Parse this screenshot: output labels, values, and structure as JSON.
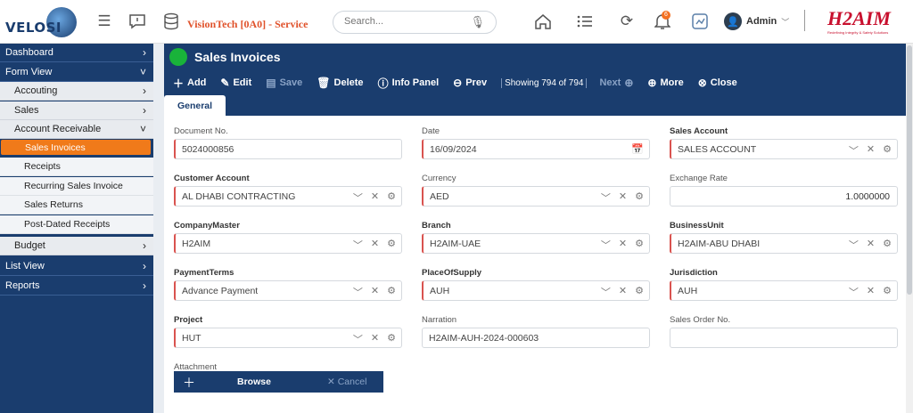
{
  "header": {
    "logo_text": "VELOSI",
    "company": "VisionTech [0A0] - Service",
    "search_placeholder": "Search...",
    "notifications_count": "6",
    "user": "Admin",
    "brand_name": "H2AIM",
    "brand_tagline": "Redefining Integrity & Safety Solutions"
  },
  "sidebar": {
    "dashboard": "Dashboard",
    "form_view": "Form View",
    "accounting": "Accouting",
    "sales": "Sales",
    "account_receivable": "Account Receivable",
    "items": [
      "Sales Invoices",
      "Receipts",
      "Recurring Sales Invoice",
      "Sales Returns",
      "Post-Dated Receipts"
    ],
    "budget": "Budget",
    "list_view": "List View",
    "reports": "Reports"
  },
  "page": {
    "title": "Sales Invoices",
    "toolbar": {
      "add": "Add",
      "edit": "Edit",
      "save": "Save",
      "delete": "Delete",
      "info": "Info Panel",
      "prev": "Prev",
      "showing": "Showing 794 of 794",
      "next": "Next",
      "more": "More",
      "close": "Close"
    },
    "tab": "General"
  },
  "form": {
    "document_no": {
      "label": "Document No.",
      "value": "5024000856"
    },
    "date": {
      "label": "Date",
      "value": "16/09/2024"
    },
    "sales_account": {
      "label": "Sales Account",
      "value": "SALES ACCOUNT"
    },
    "customer_account": {
      "label": "Customer Account",
      "value": "AL DHABI CONTRACTING"
    },
    "currency": {
      "label": "Currency",
      "value": "AED"
    },
    "exchange_rate": {
      "label": "Exchange Rate",
      "value": "1.0000000"
    },
    "company_master": {
      "label": "CompanyMaster",
      "value": "H2AIM"
    },
    "branch": {
      "label": "Branch",
      "value": "H2AIM-UAE"
    },
    "business_unit": {
      "label": "BusinessUnit",
      "value": "H2AIM-ABU DHABI"
    },
    "payment_terms": {
      "label": "PaymentTerms",
      "value": "Advance Payment"
    },
    "place_of_supply": {
      "label": "PlaceOfSupply",
      "value": "AUH"
    },
    "jurisdiction": {
      "label": "Jurisdiction",
      "value": "AUH"
    },
    "project": {
      "label": "Project",
      "value": "HUT"
    },
    "narration": {
      "label": "Narration",
      "value": "H2AIM-AUH-2024-000603"
    },
    "sales_order_no": {
      "label": "Sales Order No.",
      "value": ""
    },
    "attachment": {
      "label": "Attachment",
      "browse": "Browse",
      "cancel": "Cancel"
    }
  }
}
